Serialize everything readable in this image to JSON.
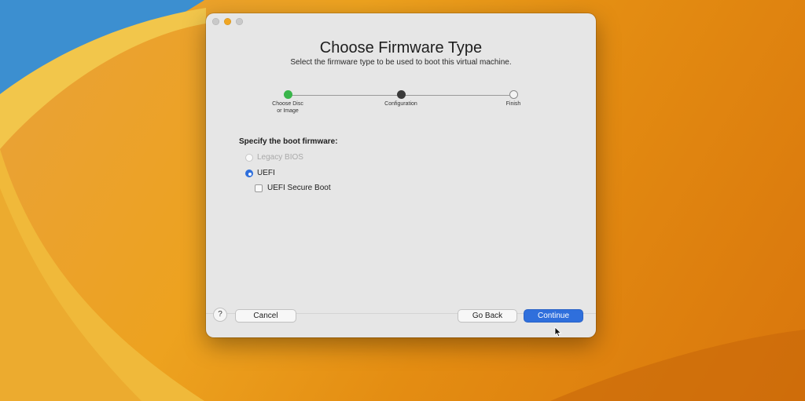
{
  "dialog": {
    "title": "Choose Firmware Type",
    "subtitle": "Select the firmware type to be used to boot this virtual machine."
  },
  "steps": [
    {
      "label": "Choose Disc\nor Image",
      "state": "done"
    },
    {
      "label": "Configuration",
      "state": "current"
    },
    {
      "label": "Finish",
      "state": "todo"
    }
  ],
  "firmware": {
    "section_label": "Specify the boot firmware:",
    "options": [
      {
        "label": "Legacy BIOS",
        "selected": false,
        "enabled": false
      },
      {
        "label": "UEFI",
        "selected": true,
        "enabled": true
      }
    ],
    "secure_boot": {
      "label": "UEFI Secure Boot",
      "checked": false
    }
  },
  "footer": {
    "help_label": "?",
    "cancel_label": "Cancel",
    "back_label": "Go Back",
    "continue_label": "Continue"
  },
  "colors": {
    "accent": "#2f6fdc",
    "step_done": "#39b54a",
    "step_current": "#3a3a3a"
  }
}
